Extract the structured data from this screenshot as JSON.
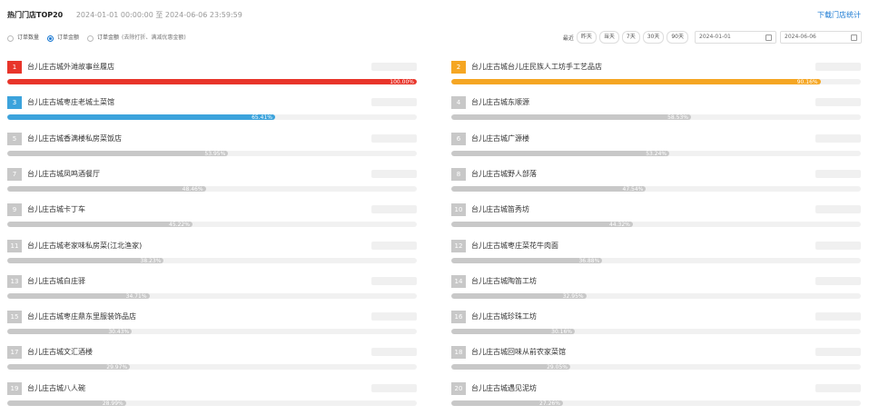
{
  "header": {
    "title": "热门门店TOP20",
    "range": "2024-01-01 00:00:00 至 2024-06-06 23:59:59",
    "download": "下载门店统计"
  },
  "options": [
    {
      "label": "订单数量",
      "note": "",
      "selected": false
    },
    {
      "label": "订单金额",
      "note": "",
      "selected": true
    },
    {
      "label": "订单金额",
      "note": "(去除打折、满减优惠金额)",
      "selected": false
    }
  ],
  "toolbar": {
    "recent_label": "最近",
    "quick_ranges": [
      "昨天",
      "当天",
      "7天",
      "30天",
      "90天"
    ],
    "start_date": "2024-01-01",
    "end_date": "2024-06-06"
  },
  "colors": {
    "rank1": "#e8352a",
    "rank2": "#f5a623",
    "rank3": "#3ca3dc",
    "rest": "#c8c8c8",
    "accent": "#1677d2"
  },
  "ranking": [
    {
      "rank": "1",
      "name": "台儿庄古城外滩故事丝履店",
      "amount": "",
      "percent_label": "100.00%",
      "percent": 100
    },
    {
      "rank": "2",
      "name": "台儿庄古城台儿庄民族人工坊手工艺品店",
      "amount": "",
      "percent_label": "90.16%",
      "percent": 90.16
    },
    {
      "rank": "3",
      "name": "台儿庄古城枣庄老城土菜馆",
      "amount": "",
      "percent_label": "65.41%",
      "percent": 65.41
    },
    {
      "rank": "4",
      "name": "台儿庄古城东顺源",
      "amount": "",
      "percent_label": "58.53%",
      "percent": 58.53
    },
    {
      "rank": "5",
      "name": "台儿庄古城香满楼私房菜饭店",
      "amount": "",
      "percent_label": "53.95%",
      "percent": 53.95
    },
    {
      "rank": "6",
      "name": "台儿庄古城广源楼",
      "amount": "",
      "percent_label": "53.24%",
      "percent": 53.24
    },
    {
      "rank": "7",
      "name": "台儿庄古城凤鸣酒餐厅",
      "amount": "",
      "percent_label": "48.46%",
      "percent": 48.46
    },
    {
      "rank": "8",
      "name": "台儿庄古城野人部落",
      "amount": "",
      "percent_label": "47.54%",
      "percent": 47.54
    },
    {
      "rank": "9",
      "name": "台儿庄古城卡丁车",
      "amount": "",
      "percent_label": "45.22%",
      "percent": 45.22
    },
    {
      "rank": "10",
      "name": "台儿庄古城笛秀坊",
      "amount": "",
      "percent_label": "44.32%",
      "percent": 44.32
    },
    {
      "rank": "11",
      "name": "台儿庄古城老家味私房菜(江北渔家)",
      "amount": "",
      "percent_label": "38.23%",
      "percent": 38.23
    },
    {
      "rank": "12",
      "name": "台儿庄古城枣庄菜花牛肉面",
      "amount": "",
      "percent_label": "36.88%",
      "percent": 36.88
    },
    {
      "rank": "13",
      "name": "台儿庄古城白庄驿",
      "amount": "",
      "percent_label": "34.71%",
      "percent": 34.71
    },
    {
      "rank": "14",
      "name": "台儿庄古城陶笛工坊",
      "amount": "",
      "percent_label": "32.95%",
      "percent": 32.95
    },
    {
      "rank": "15",
      "name": "台儿庄古城枣庄鼎东里服装饰品店",
      "amount": "",
      "percent_label": "30.43%",
      "percent": 30.43
    },
    {
      "rank": "16",
      "name": "台儿庄古城珍珠工坊",
      "amount": "",
      "percent_label": "30.16%",
      "percent": 30.16
    },
    {
      "rank": "17",
      "name": "台儿庄古城文汇酒楼",
      "amount": "",
      "percent_label": "29.97%",
      "percent": 29.97
    },
    {
      "rank": "18",
      "name": "台儿庄古城回味从前农家菜馆",
      "amount": "",
      "percent_label": "29.05%",
      "percent": 29.05
    },
    {
      "rank": "19",
      "name": "台儿庄古城八人碗",
      "amount": "",
      "percent_label": "28.99%",
      "percent": 28.99
    },
    {
      "rank": "20",
      "name": "台儿庄古城遇见泥坊",
      "amount": "",
      "percent_label": "27.26%",
      "percent": 27.26
    }
  ]
}
